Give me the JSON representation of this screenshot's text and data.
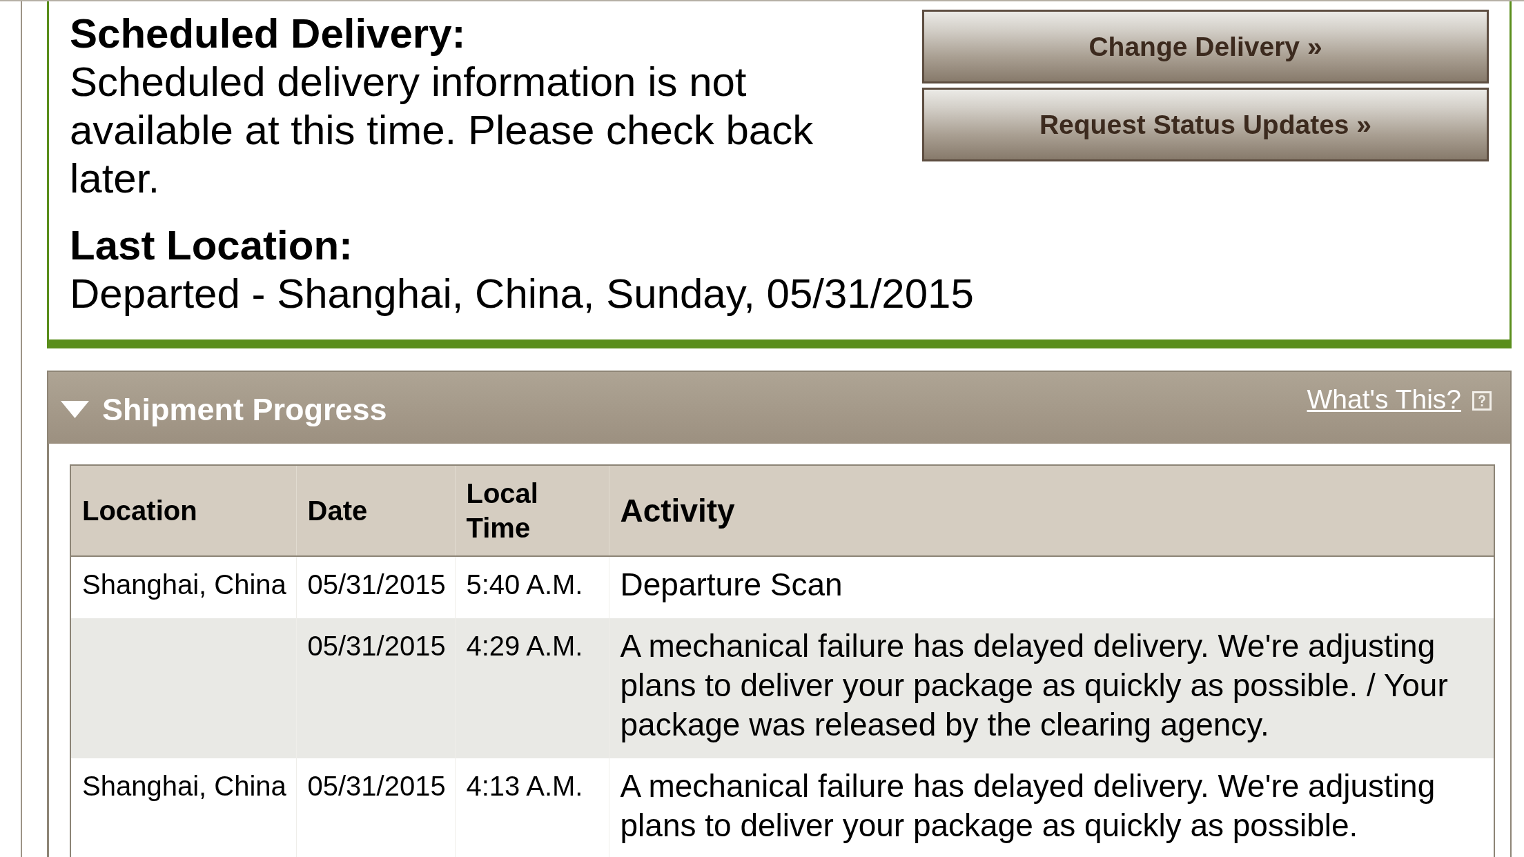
{
  "summary": {
    "scheduled_delivery": {
      "heading": "Scheduled Delivery:",
      "text": "Scheduled delivery information is not available at this time. Please check back later."
    },
    "last_location": {
      "heading": "Last Location:",
      "text": "Departed - Shanghai, China, Sunday, 05/31/2015"
    },
    "buttons": [
      "Change Delivery »",
      "Request Status Updates »"
    ]
  },
  "shipment_progress": {
    "title": "Shipment Progress",
    "expanded": true,
    "help_link": "What's This?",
    "table": {
      "columns": [
        "Location",
        "Date",
        "Local Time",
        "Activity"
      ],
      "rows": [
        {
          "location": "Shanghai, China",
          "date": "05/31/2015",
          "local_time": "5:40 A.M.",
          "activity": "Departure Scan"
        },
        {
          "date": "05/31/2015",
          "local_time": "4:29 A.M.",
          "activity": "A mechanical failure has delayed delivery. We're adjusting plans to deliver your package as quickly as possible. / Your package was released by the clearing agency."
        },
        {
          "location": "Shanghai, China",
          "date": "05/31/2015",
          "local_time": "4:13 A.M.",
          "activity": "A mechanical failure has delayed delivery. We're adjusting plans to deliver your package as quickly as possible."
        }
      ]
    }
  }
}
